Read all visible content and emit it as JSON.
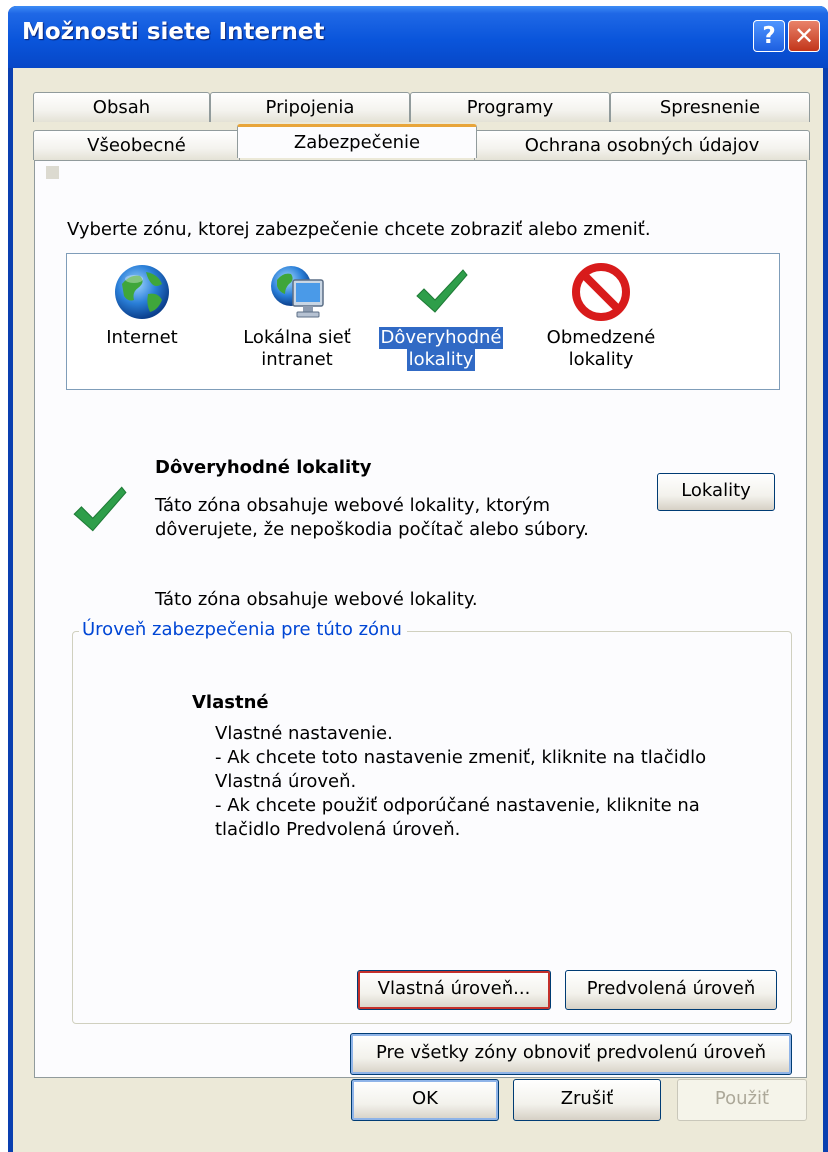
{
  "window": {
    "title": "Možnosti siete Internet",
    "help_glyph": "?",
    "close_glyph": "✕"
  },
  "tabs_row1": [
    {
      "label": "Obsah"
    },
    {
      "label": "Pripojenia"
    },
    {
      "label": "Programy"
    },
    {
      "label": "Spresnenie"
    }
  ],
  "tabs_row2": [
    {
      "label": "Všeobecné"
    },
    {
      "label": "Zabezpečenie",
      "active": true
    },
    {
      "label": "Ochrana osobných údajov"
    }
  ],
  "security": {
    "instruction": "Vyberte zónu, ktorej zabezpečenie chcete zobraziť alebo zmeniť.",
    "zones": [
      {
        "line1": "Internet",
        "line2": "",
        "icon": "globe-icon"
      },
      {
        "line1": "Lokálna sieť",
        "line2": "intranet",
        "icon": "intranet-icon"
      },
      {
        "line1": "Dôveryhodné",
        "line2": "lokality",
        "icon": "checkmark-icon",
        "selected": true
      },
      {
        "line1": "Obmedzené",
        "line2": "lokality",
        "icon": "prohibited-icon"
      }
    ],
    "zone_title": "Dôveryhodné lokality",
    "zone_desc_line1": "Táto zóna obsahuje webové lokality, ktorým",
    "zone_desc_line2": "dôverujete, že nepoškodia počítač alebo súbory.",
    "sites_button": "Lokality",
    "zone_note": "Táto zóna obsahuje webové lokality.",
    "level_group_title": "Úroveň zabezpečenia pre túto zónu",
    "level_name": "Vlastné",
    "level_lines": [
      "Vlastné nastavenie.",
      "- Ak chcete toto nastavenie zmeniť, kliknite na tlačidlo",
      "Vlastná úroveň.",
      "- Ak chcete použiť odporúčané nastavenie, kliknite na",
      "tlačidlo Predvolená úroveň."
    ],
    "custom_level_button": "Vlastná úroveň...",
    "default_level_button": "Predvolená úroveň",
    "reset_all_button": "Pre všetky zóny obnoviť predvolenú úroveň"
  },
  "footer": {
    "ok": "OK",
    "cancel": "Zrušiť",
    "apply": "Použiť"
  },
  "colors": {
    "titlebar": "#0a55db",
    "selection": "#316ac5",
    "check_green": "#2e9e4a",
    "prohibited_red": "#d81b1b"
  }
}
